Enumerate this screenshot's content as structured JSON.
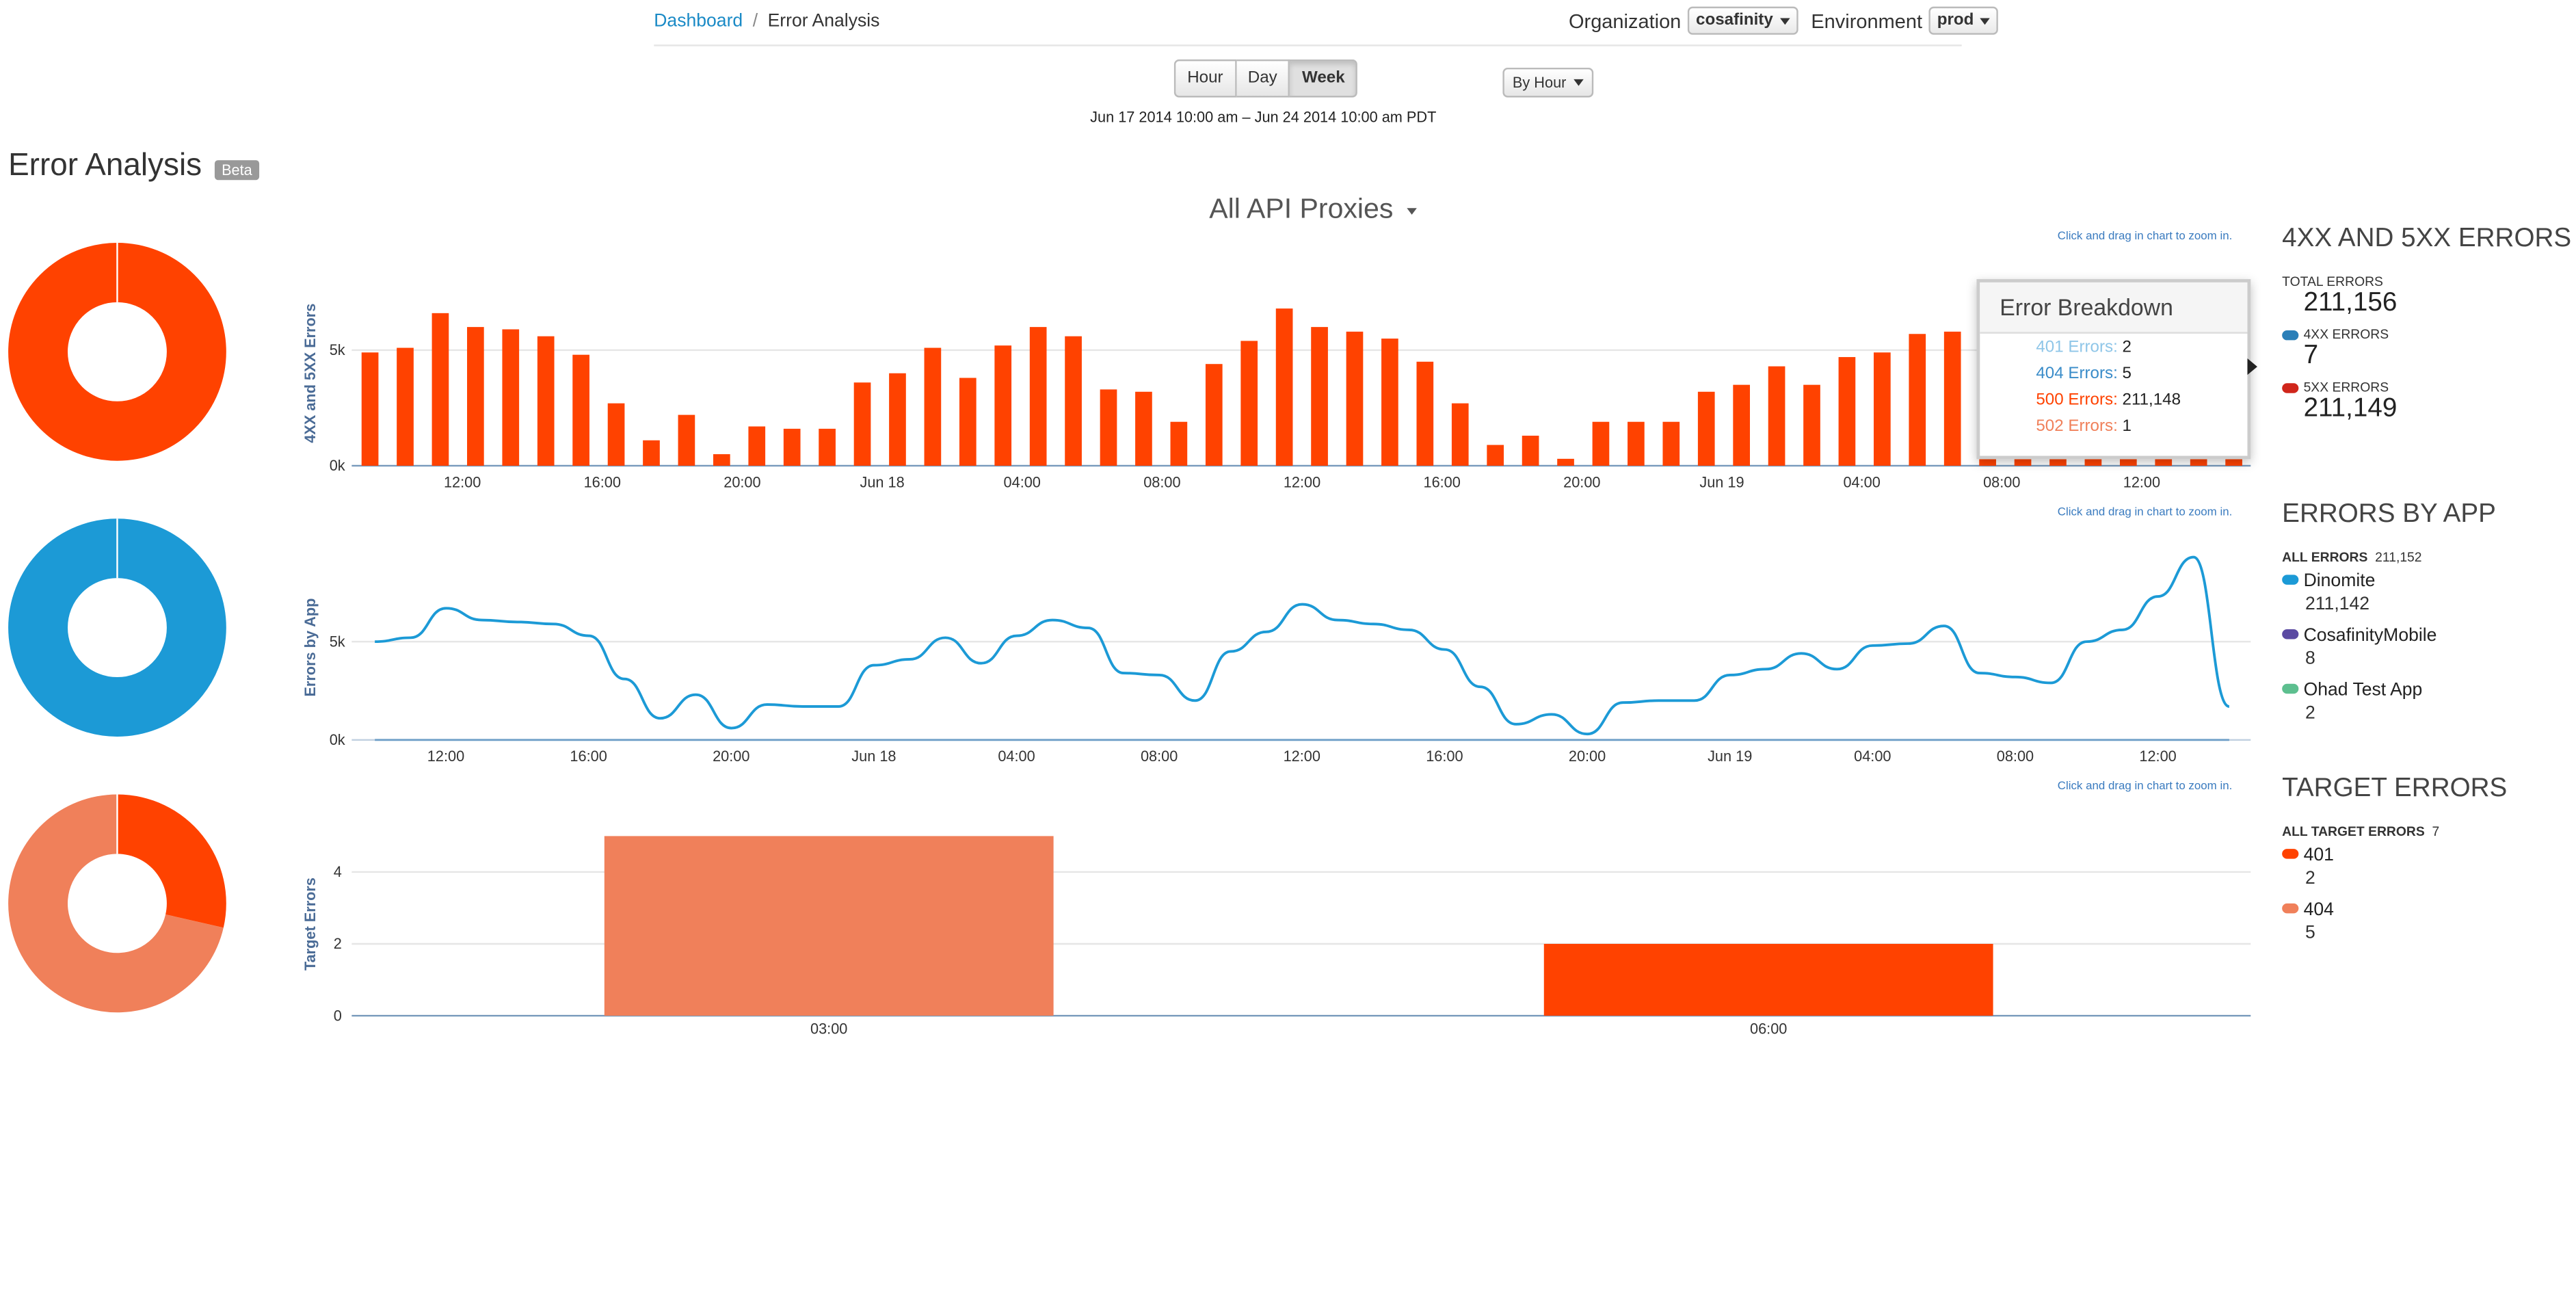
{
  "breadcrumb": {
    "home": "Dashboard",
    "separator": "/",
    "current": "Error Analysis"
  },
  "org": {
    "label": "Organization",
    "value": "cosafinity"
  },
  "env": {
    "label": "Environment",
    "value": "prod"
  },
  "range": {
    "buttons": [
      "Hour",
      "Day",
      "Week"
    ],
    "active": "Week",
    "group_by": "By Hour",
    "text": "Jun 17 2014 10:00 am  –  Jun 24 2014 10:00 am PDT"
  },
  "page": {
    "title": "Error Analysis",
    "badge": "Beta"
  },
  "proxy_selector": "All API Proxies",
  "hint": "Click and drag in chart to zoom in.",
  "colors": {
    "red": "#ff4200",
    "blue": "#1c9ad6",
    "salmon": "#f0805a",
    "purple": "#5b4aa2",
    "green": "#5dbf8f",
    "link": "#1a8ac6"
  },
  "errors_panel": {
    "heading": "4XX AND 5XX ERRORS",
    "total_label": "TOTAL ERRORS",
    "total": "211,156",
    "c4xx_label": "4XX ERRORS",
    "c4xx": "7",
    "c5xx_label": "5XX ERRORS",
    "c5xx": "211,149"
  },
  "tooltip": {
    "title": "Error Breakdown",
    "rows": [
      {
        "label": "401 Errors:",
        "value": "2",
        "color": "#8fc6e8"
      },
      {
        "label": "404 Errors:",
        "value": "5",
        "color": "#3a8cc9"
      },
      {
        "label": "500 Errors:",
        "value": "211,148",
        "color": "#ff4200"
      },
      {
        "label": "502 Errors:",
        "value": "1",
        "color": "#f0805a"
      }
    ]
  },
  "apps_panel": {
    "heading": "ERRORS BY APP",
    "all_label": "ALL ERRORS",
    "all_value": "211,152",
    "apps": [
      {
        "name": "Dinomite",
        "value": "211,142",
        "color": "#1c9ad6"
      },
      {
        "name": "CosafinityMobile",
        "value": "8",
        "color": "#5b4aa2"
      },
      {
        "name": "Ohad Test App",
        "value": "2",
        "color": "#5dbf8f"
      }
    ]
  },
  "target_panel": {
    "heading": "TARGET ERRORS",
    "all_label": "ALL TARGET ERRORS",
    "all_value": "7",
    "items": [
      {
        "name": "401",
        "value": "2",
        "color": "#ff4200"
      },
      {
        "name": "404",
        "value": "5",
        "color": "#f0805a"
      }
    ]
  },
  "chart_data": [
    {
      "type": "bar",
      "ylabel": "4XX and 5XX Errors",
      "ylim": [
        0,
        8000
      ],
      "yticks": [
        "0k",
        "5k"
      ],
      "x_ticks": [
        "12:00",
        "16:00",
        "20:00",
        "Jun 18",
        "04:00",
        "08:00",
        "12:00",
        "16:00",
        "20:00",
        "Jun 19",
        "04:00",
        "08:00",
        "12:00"
      ],
      "series": [
        {
          "values": [
            4900,
            5100,
            6600,
            6000,
            5900,
            5600,
            4800,
            2700,
            1100,
            2200,
            500,
            1700,
            1600,
            1600,
            3600,
            4000,
            5100,
            3800,
            5200,
            6000,
            5600,
            3300,
            3200,
            1900,
            4400,
            5400,
            6800,
            6000,
            5800,
            5500,
            4500,
            2700,
            900,
            1300,
            300,
            1900,
            1900,
            1900,
            3200,
            3500,
            4300,
            3500,
            4700,
            4900,
            5700,
            5800,
            5900,
            6000,
            6000,
            6100,
            6200,
            6300,
            6300,
            6200
          ]
        }
      ]
    },
    {
      "type": "line",
      "ylabel": "Errors by App",
      "ylim": [
        0,
        8000
      ],
      "yticks": [
        "0k",
        "5k"
      ],
      "x_ticks": [
        "12:00",
        "16:00",
        "20:00",
        "Jun 18",
        "04:00",
        "08:00",
        "12:00",
        "16:00",
        "20:00",
        "Jun 19",
        "04:00",
        "08:00",
        "12:00"
      ],
      "series": [
        {
          "name": "Dinomite",
          "values": [
            5000,
            5200,
            6700,
            6100,
            6000,
            5900,
            5300,
            3100,
            1100,
            2300,
            600,
            1800,
            1700,
            1700,
            3800,
            4100,
            5200,
            3900,
            5300,
            6100,
            5700,
            3400,
            3300,
            2000,
            4500,
            5500,
            6900,
            6100,
            5900,
            5600,
            4600,
            2700,
            800,
            1300,
            300,
            1900,
            2000,
            2000,
            3300,
            3600,
            4400,
            3600,
            4800,
            4900,
            5800,
            3400,
            3200,
            2900,
            5000,
            5600,
            7300,
            9300,
            1700
          ]
        },
        {
          "name": "CosafinityMobile",
          "values": [
            0,
            0,
            0,
            0,
            0,
            0,
            0,
            0,
            0,
            0,
            0,
            0,
            0,
            0,
            0,
            0,
            0,
            0,
            0,
            0,
            0,
            0,
            0,
            0,
            0,
            0,
            0,
            0,
            0,
            0,
            0,
            0,
            0,
            0,
            0,
            0,
            0,
            0,
            0,
            0,
            0,
            0,
            0,
            0,
            0,
            0,
            0,
            0,
            0,
            0,
            0,
            0,
            0
          ]
        }
      ]
    },
    {
      "type": "bar",
      "ylabel": "Target Errors",
      "ylim": [
        0,
        5
      ],
      "yticks": [
        "0",
        "2",
        "4"
      ],
      "categories": [
        "03:00",
        "06:00"
      ],
      "values": [
        5,
        2
      ],
      "colors": [
        "#f0805a",
        "#ff4200"
      ]
    },
    {
      "type": "pie",
      "labels": [
        "5XX ERRORS",
        "4XX ERRORS"
      ],
      "values": [
        211149,
        7
      ]
    },
    {
      "type": "pie",
      "labels": [
        "Dinomite",
        "CosafinityMobile",
        "Ohad Test App"
      ],
      "values": [
        211142,
        8,
        2
      ]
    },
    {
      "type": "pie",
      "labels": [
        "401",
        "404"
      ],
      "values": [
        2,
        5
      ]
    }
  ]
}
